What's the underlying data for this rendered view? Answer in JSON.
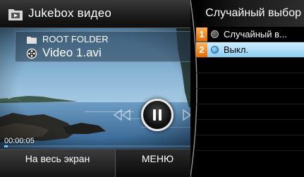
{
  "left_panel": {
    "title": "Jukebox видео",
    "title_icon": "video-folder-icon",
    "folder": {
      "icon": "folder-icon",
      "name": "ROOT FOLDER"
    },
    "file": {
      "icon": "video-file-icon",
      "name": "Video 1.avi"
    },
    "playback": {
      "time": "00:00:05",
      "progress": 0.02,
      "prev_icon": "rewind-icon",
      "play_state_icon": "pause-icon",
      "next_icon": "fast-forward-icon"
    },
    "bottom_buttons": {
      "fullscreen_label": "На весь экран",
      "menu_label": "МЕНЮ"
    }
  },
  "right_panel": {
    "title": "Случайный выбор",
    "options": [
      {
        "number": "1",
        "label": "Случайный в...",
        "selected": false
      },
      {
        "number": "2",
        "label": "Выкл.",
        "selected": true
      }
    ]
  },
  "colors": {
    "accent_blue": "#8ccdf0",
    "number_badge": "#f07a10",
    "progress": "#6fc6ff"
  }
}
